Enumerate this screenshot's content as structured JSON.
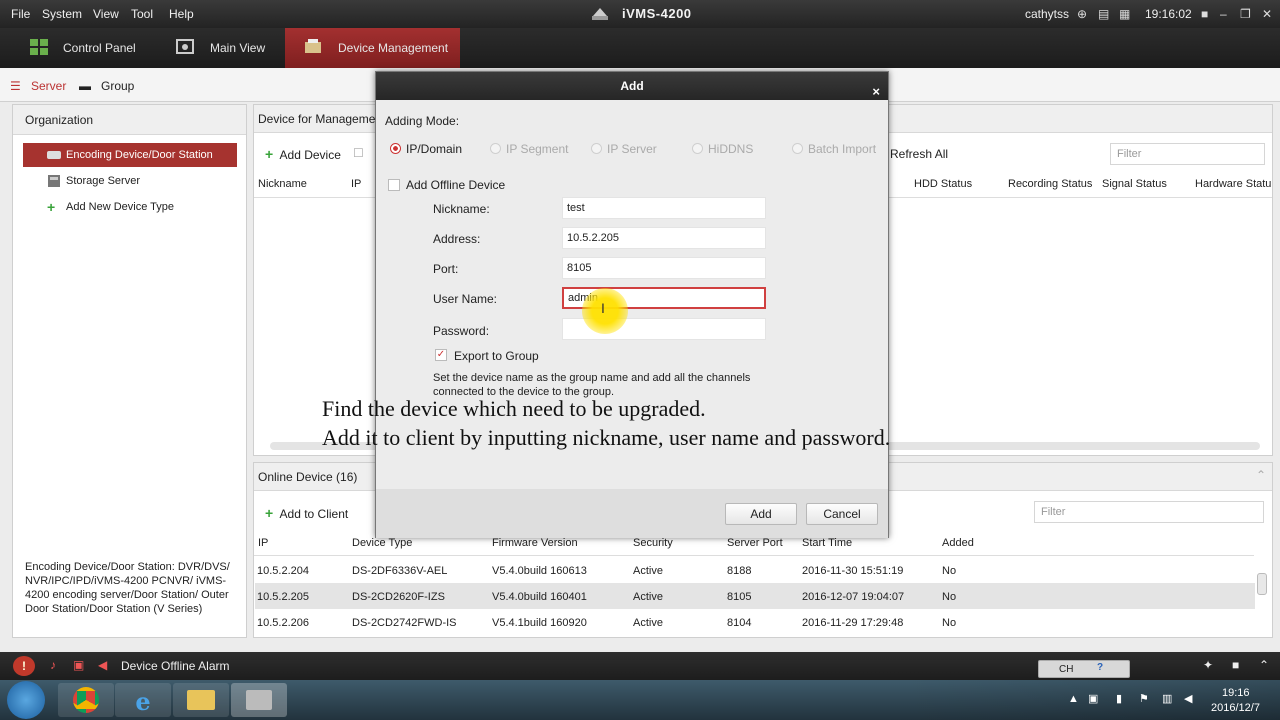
{
  "menubar": {
    "menus": [
      "File",
      "System",
      "View",
      "Tool",
      "Help"
    ],
    "app_title": "iVMS-4200",
    "user": "cathytss",
    "clock": "19:16:02"
  },
  "tabs": [
    {
      "label": "Control Panel"
    },
    {
      "label": "Main View"
    },
    {
      "label": "Device Management"
    }
  ],
  "subtabs": {
    "server": "Server",
    "group": "Group"
  },
  "organization": {
    "title": "Organization",
    "items": [
      "Encoding Device/Door Station",
      "Storage Server",
      "Add New Device Type"
    ],
    "description": "Encoding Device/Door Station: DVR/DVS/ NVR/IPC/IPD/iVMS-4200 PCNVR/ iVMS-4200 encoding server/Door Station/ Outer Door Station/Door Station (V Series)"
  },
  "management": {
    "title": "Device for Management",
    "add_device": "Add Device",
    "refresh_all": "Refresh All",
    "filter_placeholder": "Filter",
    "columns": [
      "Nickname",
      "IP",
      "HDD Status",
      "Recording Status",
      "Signal Status",
      "Hardware Statu"
    ]
  },
  "online": {
    "title": "Online Device (16)",
    "add_to_client": "Add to Client",
    "filter_placeholder": "Filter",
    "columns": [
      "IP",
      "Device Type",
      "Firmware Version",
      "Security",
      "Server Port",
      "Start Time",
      "Added"
    ],
    "rows": [
      {
        "ip": "10.5.2.204",
        "type": "DS-2DF6336V-AEL",
        "firmware": "V5.4.0build 160613",
        "security": "Active",
        "port": "8188",
        "start": "2016-11-30 15:51:19",
        "added": "No"
      },
      {
        "ip": "10.5.2.205",
        "type": "DS-2CD2620F-IZS",
        "firmware": "V5.4.0build 160401",
        "security": "Active",
        "port": "8105",
        "start": "2016-12-07 19:04:07",
        "added": "No"
      },
      {
        "ip": "10.5.2.206",
        "type": "DS-2CD2742FWD-IS",
        "firmware": "V5.4.1build 160920",
        "security": "Active",
        "port": "8104",
        "start": "2016-11-29 17:29:48",
        "added": "No"
      }
    ]
  },
  "dialog": {
    "title": "Add",
    "close": "×",
    "adding_mode_label": "Adding Mode:",
    "modes": [
      "IP/Domain",
      "IP Segment",
      "IP Server",
      "HiDDNS",
      "Batch Import"
    ],
    "add_offline": "Add Offline Device",
    "fields": {
      "nickname": {
        "label": "Nickname:",
        "value": "test"
      },
      "address": {
        "label": "Address:",
        "value": "10.5.2.205"
      },
      "port": {
        "label": "Port:",
        "value": "8105"
      },
      "username": {
        "label": "User Name:",
        "value": "admin"
      },
      "password": {
        "label": "Password:",
        "value": ""
      }
    },
    "export_group": "Export to Group",
    "export_note": "Set the device name as the group name and add all the channels connected to the device to the group.",
    "add_button": "Add",
    "cancel_button": "Cancel"
  },
  "caption": {
    "line1": "Find the device which need to be upgraded.",
    "line2": "Add it to client by inputting nickname, user name and password."
  },
  "statusbar": {
    "alarm": "Device Offline Alarm"
  },
  "taskbar": {
    "time": "19:16",
    "date": "2016/12/7",
    "lang": "CH"
  },
  "colors": {
    "accent": "#a6332f",
    "plus": "#39a33a"
  }
}
